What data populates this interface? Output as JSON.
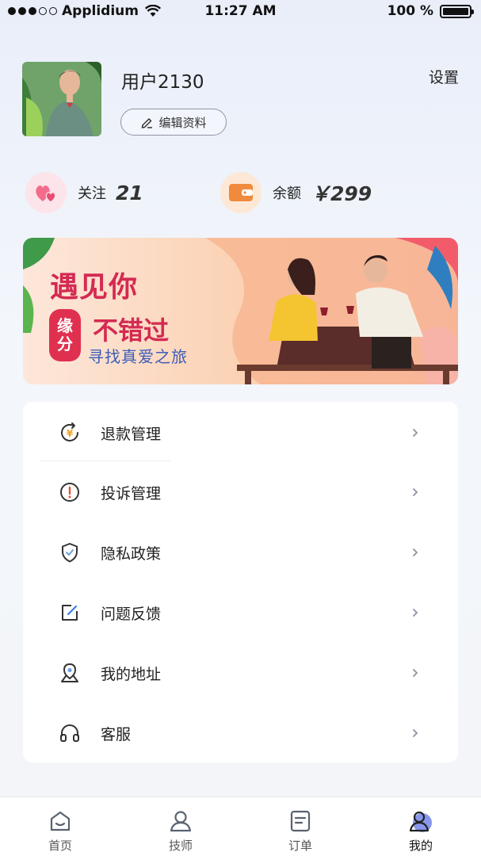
{
  "status_bar": {
    "carrier": "Applidium",
    "time": "11:27 AM",
    "battery": "100 %"
  },
  "profile": {
    "username": "用户2130",
    "edit_label": "编辑资料",
    "settings_label": "设置"
  },
  "stats": {
    "follow": {
      "label": "关注",
      "value": "21"
    },
    "balance": {
      "label": "余额",
      "value": "￥299"
    }
  },
  "banner": {
    "title": "遇见你",
    "fate_char_1": "缘",
    "fate_char_2": "分",
    "subtitle_line": "不错过",
    "tagline": "寻找真爱之旅"
  },
  "menu": {
    "items": [
      {
        "label": "退款管理",
        "icon": "refund-icon"
      },
      {
        "label": "投诉管理",
        "icon": "complaint-icon"
      },
      {
        "label": "隐私政策",
        "icon": "shield-icon"
      },
      {
        "label": "问题反馈",
        "icon": "edit-feedback-icon"
      },
      {
        "label": "我的地址",
        "icon": "location-icon"
      },
      {
        "label": "客服",
        "icon": "headset-icon"
      }
    ]
  },
  "tabs": [
    {
      "label": "首页",
      "icon": "home-icon"
    },
    {
      "label": "技师",
      "icon": "person-icon"
    },
    {
      "label": "订单",
      "icon": "order-icon"
    },
    {
      "label": "我的",
      "icon": "my-profile-icon",
      "active": true
    }
  ],
  "colors": {
    "accent_red": "#d42a52",
    "accent_blue": "#3a5db8",
    "heart_pink": "#f36c8c",
    "wallet_orange": "#f08a3c",
    "active_tab": "#7b8ce9"
  }
}
